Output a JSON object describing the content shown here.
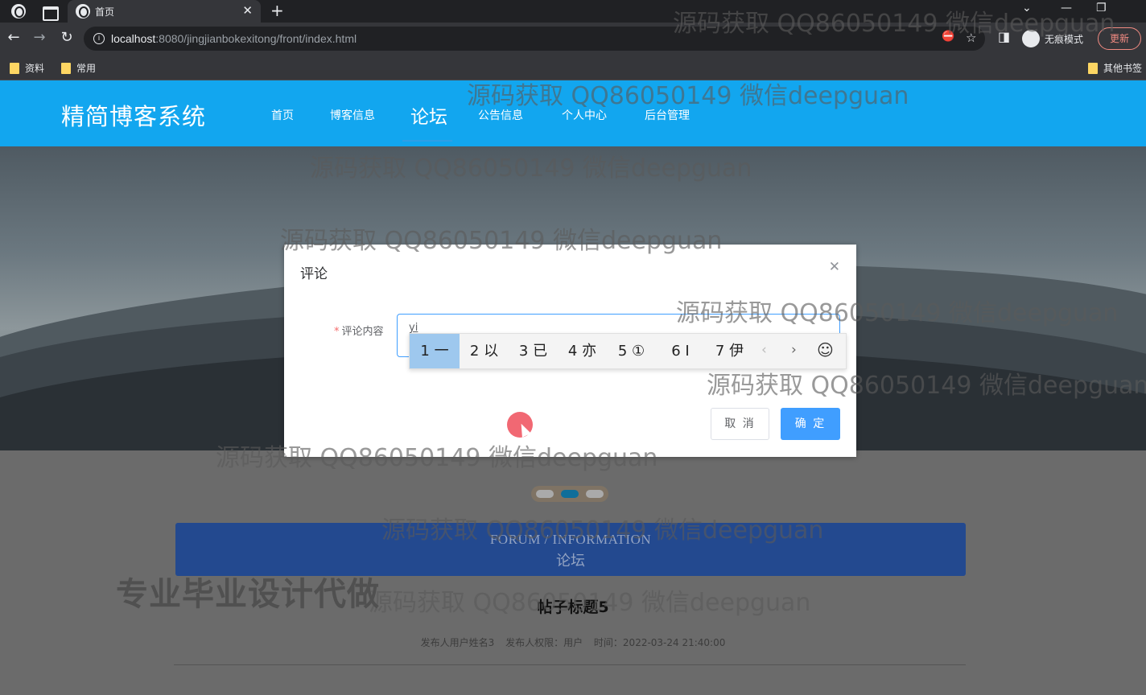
{
  "browser": {
    "tab_title": "首页",
    "url_host": "localhost",
    "url_path": ":8080/jingjianbokexitong/front/index.html",
    "incognito_label": "无痕模式",
    "update_label": "更新",
    "bookmarks": [
      "资料",
      "常用"
    ],
    "other_bookmarks": "其他书签"
  },
  "site": {
    "logo": "精简博客系统",
    "nav": [
      "首页",
      "博客信息",
      "论坛",
      "公告信息",
      "个人中心",
      "后台管理"
    ],
    "active_nav": "论坛"
  },
  "forum": {
    "heading_en": "FORUM / INFORMATION",
    "heading_cn": "论坛",
    "post_title": "帖子标题5",
    "meta_author": "发布人用户姓名3",
    "meta_role": "发布人权限：用户",
    "meta_time": "时间：2022-03-24 21:40:00"
  },
  "dialog": {
    "title": "评论",
    "field_label": "评论内容",
    "field_value": "yi",
    "cancel_label": "取 消",
    "confirm_label": "确 定"
  },
  "ime": {
    "candidates": [
      "1 一",
      "2 以",
      "3 已",
      "4 亦",
      "5 ①",
      "6 I",
      "7 伊"
    ],
    "selected_index": 0
  },
  "overlays": {
    "watermark": "源码获取 QQ86050149 微信deepguan",
    "promo": "专业毕业设计代做"
  },
  "colors": {
    "header_blue": "#12a6ef",
    "primary_button": "#409eff",
    "forum_bar": "#23498f"
  }
}
